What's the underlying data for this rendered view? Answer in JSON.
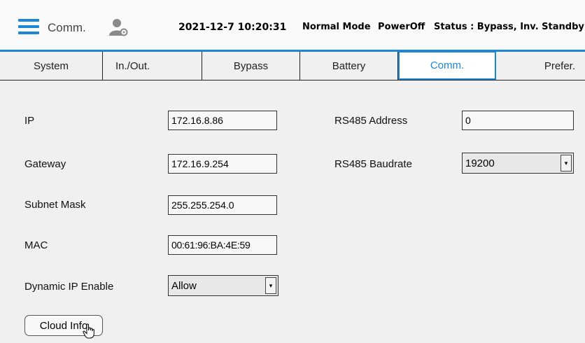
{
  "header": {
    "title": "Comm.",
    "datetime": "2021-12-7 10:20:31",
    "mode": "Normal Mode",
    "power": "PowerOff",
    "status": "Status : Bypass, Inv. Standby",
    "accent_color": "#1e86d6",
    "menu_icon": "hamburger-menu-icon",
    "user_icon": "user-settings-icon"
  },
  "tabs": [
    {
      "label": "System",
      "active": false
    },
    {
      "label": "In./Out.",
      "active": false
    },
    {
      "label": "Bypass",
      "active": false
    },
    {
      "label": "Battery",
      "active": false
    },
    {
      "label": "Comm.",
      "active": true
    },
    {
      "label": "Prefer.",
      "active": false
    }
  ],
  "network": {
    "ip": {
      "label": "IP",
      "value": "172.16.8.86"
    },
    "gateway": {
      "label": "Gateway",
      "value": "172.16.9.254"
    },
    "subnet": {
      "label": "Subnet Mask",
      "value": "255.255.254.0"
    },
    "mac": {
      "label": "MAC",
      "value": "00:61:96:BA:4E:59"
    },
    "dynamic_ip": {
      "label": "Dynamic IP Enable",
      "value": "Allow"
    }
  },
  "rs485": {
    "address": {
      "label": "RS485 Address",
      "value": "0"
    },
    "baudrate": {
      "label": "RS485 Baudrate",
      "value": "19200"
    }
  },
  "cloud_button": {
    "label": "Cloud Info"
  },
  "dropdown_arrow": "▾"
}
